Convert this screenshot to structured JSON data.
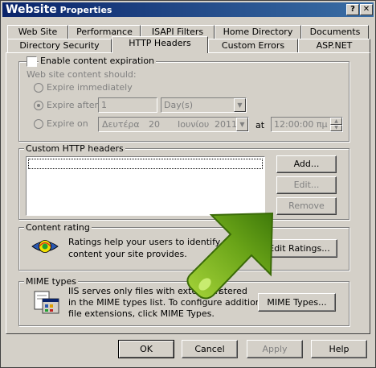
{
  "window": {
    "title_main": "Website",
    "title_rest": "Properties",
    "help_btn": "?",
    "close_btn": "✕"
  },
  "tabs_row1": [
    "Web Site",
    "Performance",
    "ISAPI Filters",
    "Home Directory",
    "Documents"
  ],
  "tabs_row2": [
    "Directory Security",
    "HTTP Headers",
    "Custom Errors",
    "ASP.NET"
  ],
  "expiration": {
    "enable_label": "Enable content expiration",
    "should_label": "Web site content should:",
    "expire_immediately": "Expire immediately",
    "expire_after": "Expire after",
    "expire_after_value": "1",
    "expire_after_unit": "Day(s)",
    "expire_on": "Expire on",
    "date_weekday": "Δευτέρα",
    "date_day": "20",
    "date_month": "Ιουνίου",
    "date_year": "2011",
    "at_label": "at",
    "time_value": "12:00:00 πμ"
  },
  "custom_headers": {
    "group_label": "Custom HTTP headers",
    "add": "Add...",
    "edit": "Edit...",
    "remove": "Remove"
  },
  "content_rating": {
    "group_label": "Content rating",
    "line1": "Ratings help your users to identify w",
    "line2": "content your site provides.",
    "edit_ratings": "Edit Ratings..."
  },
  "mime": {
    "group_label": "MIME types",
    "line1": "IIS serves only files with extension",
    "line1b": "stered",
    "line2": "in the MIME types list. To configure additional",
    "line3": "file extensions, click MIME Types.",
    "mime_button": "MIME Types..."
  },
  "footer": {
    "ok": "OK",
    "cancel": "Cancel",
    "apply": "Apply",
    "help": "Help"
  },
  "colors": {
    "titlebar_start": "#0a246a",
    "titlebar_end": "#3a6ea5",
    "arrow_green": "#5a9a10"
  }
}
